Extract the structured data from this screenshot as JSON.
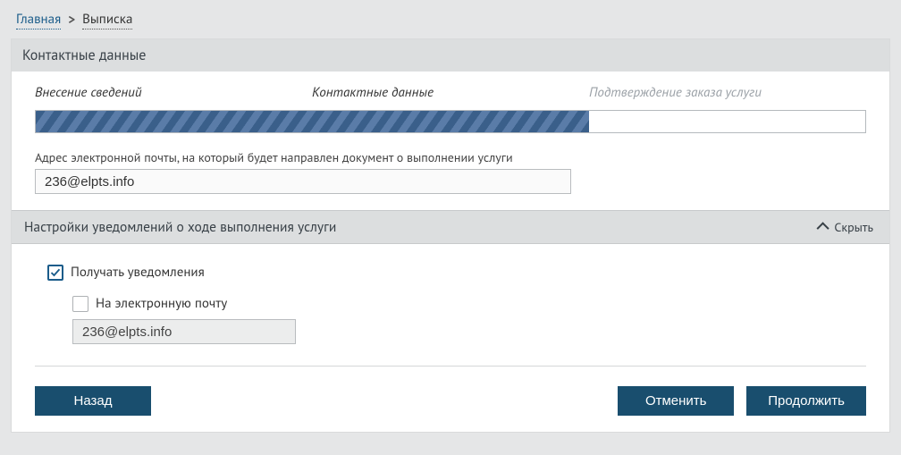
{
  "breadcrumb": {
    "home": "Главная",
    "current": "Выписка"
  },
  "panel": {
    "title": "Контактные данные"
  },
  "wizard": {
    "step1": "Внесение сведений",
    "step2": "Контактные данные",
    "step3": "Подтверждение заказа услуги"
  },
  "email": {
    "label": "Адрес электронной почты, на который будет направлен документ о выполнении услуги",
    "value": "236@elpts.info"
  },
  "notifySection": {
    "title": "Настройки уведомлений о ходе выполнения услуги",
    "hideLabel": "Скрыть",
    "receiveLabel": "Получать уведомления",
    "byEmailLabel": "На электронную почту",
    "emailValue": "236@elpts.info"
  },
  "buttons": {
    "back": "Назад",
    "cancel": "Отменить",
    "continue": "Продолжить"
  }
}
